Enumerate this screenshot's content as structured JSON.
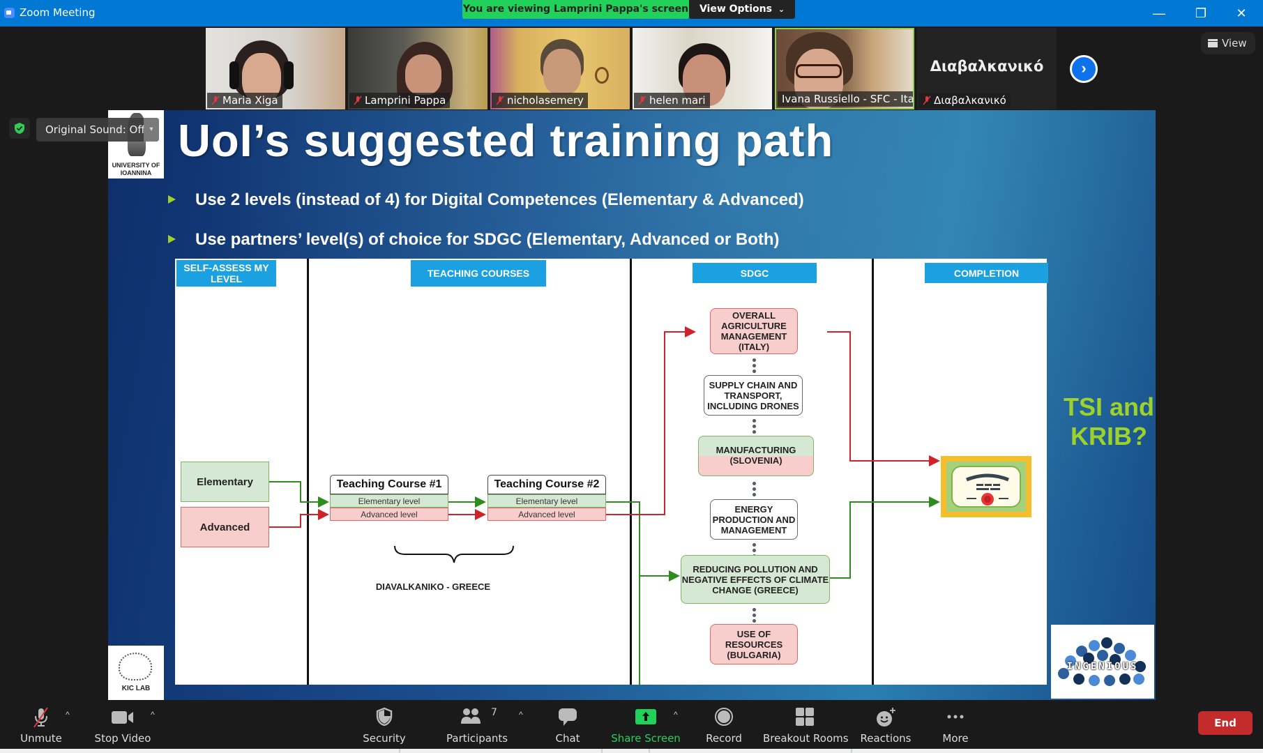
{
  "window": {
    "title": "Zoom Meeting",
    "banner": "You are viewing Lamprini Pappa's screen",
    "view_options": "View Options",
    "view_options_caret": "⌄",
    "minimize": "—",
    "restore": "❐",
    "close": "✕",
    "view_button": "View"
  },
  "gallery": {
    "participants": [
      {
        "name": "Maria Xiga",
        "muted": true
      },
      {
        "name": "Lamprini Pappa",
        "muted": true
      },
      {
        "name": "nicholasemery",
        "muted": true
      },
      {
        "name": "helen mari",
        "muted": true
      },
      {
        "name": "Ivana Russiello - SFC - Italy",
        "muted": false,
        "active_speaker": true
      },
      {
        "name": "Διαβαλκανικό",
        "muted": true,
        "video": false,
        "display_name": "Διαβαλκανικό"
      }
    ],
    "next_page_icon": "›"
  },
  "audio": {
    "original_sound": "Original Sound: Off",
    "dropdown_caret": "▾"
  },
  "slide": {
    "title": "UoI’s suggested training path",
    "bullets": [
      "Use 2 levels (instead of 4) for Digital Competences (Elementary & Advanced)",
      "Use partners’ level(s) of choice for SDGC (Elementary, Advanced or Both)"
    ],
    "side_note": "TSI and KRIB?",
    "logos": {
      "uoi": "UNIVERSITY OF IOANNINA",
      "kic": "KIC LAB",
      "ingenious": "INGENIOUS"
    },
    "diagram": {
      "headers": {
        "self_assess": "SELF-ASSESS MY LEVEL",
        "teaching": "TEACHING COURSES",
        "sdgc": "SDGC",
        "completion": "COMPLETION"
      },
      "levels": {
        "elementary": "Elementary",
        "advanced": "Advanced"
      },
      "courses": [
        {
          "title": "Teaching Course #1",
          "elementary": "Elementary level",
          "advanced": "Advanced level"
        },
        {
          "title": "Teaching Course #2",
          "elementary": "Elementary level",
          "advanced": "Advanced level"
        }
      ],
      "course_provider": "DIAVALKANIKO - GREECE",
      "sdgc_modules": [
        {
          "label": "OVERALL AGRICULTURE MANAGEMENT (ITALY)",
          "level": "advanced"
        },
        {
          "label": "SUPPLY CHAIN AND TRANSPORT, INCLUDING DRONES",
          "level": "none"
        },
        {
          "label": "MANUFACTURING (SLOVENIA)",
          "level": "both"
        },
        {
          "label": "ENERGY PRODUCTION AND MANAGEMENT",
          "level": "none"
        },
        {
          "label": "REDUCING POLLUTION AND NEGATIVE EFFECTS OF CLIMATE CHANGE (GREECE)",
          "level": "elementary"
        },
        {
          "label": "USE OF RESOURCES (BULGARIA)",
          "level": "advanced"
        }
      ],
      "completion_icon": "certificate-icon",
      "colors": {
        "header": "#1ba1e2",
        "elementary_fill": "#d5e8d4",
        "elementary_line": "#2e8b1e",
        "advanced_fill": "#f8cecc",
        "advanced_line": "#d0222a"
      }
    }
  },
  "toolbar": {
    "unmute": "Unmute",
    "stop_video": "Stop Video",
    "security": "Security",
    "participants": "Participants",
    "participants_count": "7",
    "chat": "Chat",
    "share_screen": "Share Screen",
    "record": "Record",
    "breakout_rooms": "Breakout Rooms",
    "reactions": "Reactions",
    "more": "More",
    "end": "End",
    "caret": "^"
  },
  "colors": {
    "titlebar": "#0078d4",
    "banner": "#22d15a",
    "share_green": "#22d15a",
    "end_red": "#c42b2b",
    "slide_accent": "#9ed12a"
  }
}
